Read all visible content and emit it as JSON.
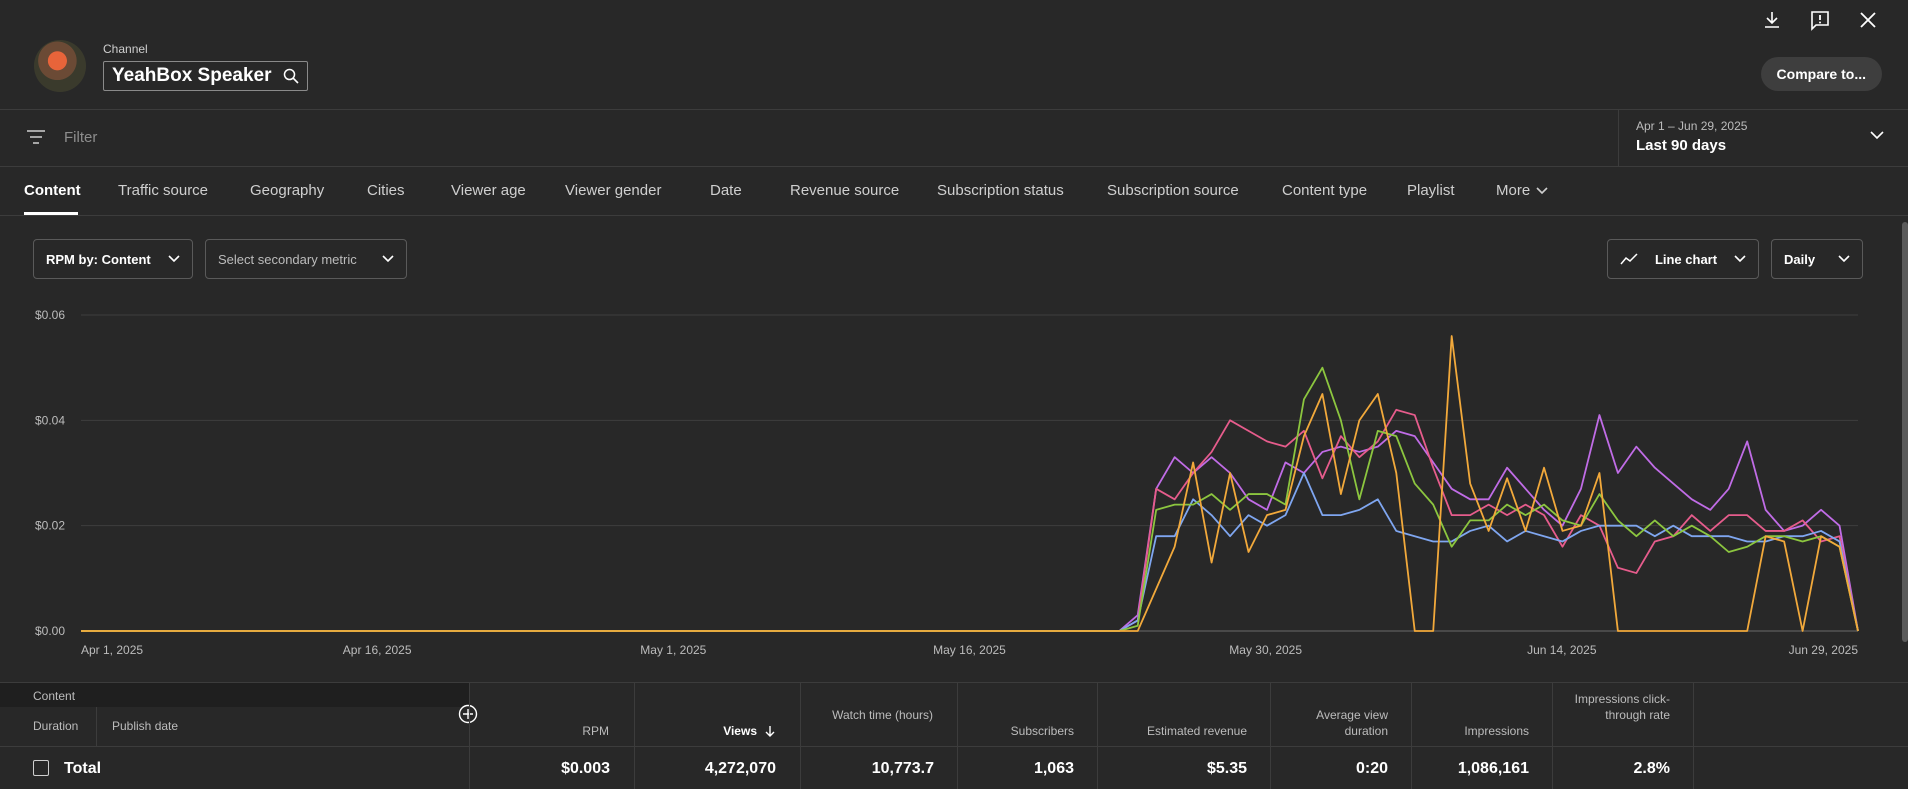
{
  "header": {
    "channel_label": "Channel",
    "channel_name": "YeahBox Speaker",
    "compare_label": "Compare to..."
  },
  "filter": {
    "placeholder": "Filter",
    "date_range": "Apr 1 – Jun 29, 2025",
    "date_label": "Last 90 days"
  },
  "tabs": [
    "Content",
    "Traffic source",
    "Geography",
    "Cities",
    "Viewer age",
    "Viewer gender",
    "Date",
    "Revenue source",
    "Subscription status",
    "Subscription source",
    "Content type",
    "Playlist",
    "More"
  ],
  "controls": {
    "primary_metric": "RPM by: Content",
    "secondary_metric": "Select secondary metric",
    "chart_type": "Line chart",
    "interval": "Daily"
  },
  "chart_data": {
    "type": "line",
    "x_labels": [
      "Apr 1, 2025",
      "Apr 16, 2025",
      "May 1, 2025",
      "May 16, 2025",
      "May 30, 2025",
      "Jun 14, 2025",
      "Jun 29, 2025"
    ],
    "y_ticks": [
      "$0.00",
      "$0.02",
      "$0.04",
      "$0.06"
    ],
    "ylim": [
      0,
      0.06
    ],
    "x_start_day": 0,
    "x_end_day": 89,
    "series_start_day": 52,
    "series": [
      {
        "color": "#c06ce6",
        "values": [
          0,
          0.003,
          0.027,
          0.033,
          0.03,
          0.033,
          0.03,
          0.025,
          0.023,
          0.032,
          0.03,
          0.034,
          0.035,
          0.034,
          0.035,
          0.038,
          0.037,
          0.032,
          0.027,
          0.025,
          0.025,
          0.031,
          0.027,
          0.023,
          0.02,
          0.027,
          0.041,
          0.03,
          0.035,
          0.031,
          0.028,
          0.025,
          0.023,
          0.027,
          0.036,
          0.023,
          0.019,
          0.02,
          0.023,
          0.02,
          0
        ]
      },
      {
        "color": "#e65c8c",
        "values": [
          0,
          0.002,
          0.027,
          0.025,
          0.03,
          0.034,
          0.04,
          0.038,
          0.036,
          0.035,
          0.038,
          0.029,
          0.037,
          0.033,
          0.036,
          0.042,
          0.041,
          0.031,
          0.022,
          0.022,
          0.024,
          0.022,
          0.024,
          0.022,
          0.016,
          0.022,
          0.02,
          0.012,
          0.011,
          0.017,
          0.018,
          0.022,
          0.019,
          0.022,
          0.022,
          0.019,
          0.019,
          0.021,
          0.017,
          0.018,
          0
        ]
      },
      {
        "color": "#7fa6f0",
        "values": [
          0,
          0.002,
          0.018,
          0.018,
          0.025,
          0.022,
          0.018,
          0.022,
          0.02,
          0.022,
          0.03,
          0.022,
          0.022,
          0.023,
          0.025,
          0.019,
          0.018,
          0.017,
          0.017,
          0.019,
          0.02,
          0.017,
          0.019,
          0.018,
          0.017,
          0.019,
          0.02,
          0.02,
          0.02,
          0.018,
          0.02,
          0.018,
          0.018,
          0.018,
          0.017,
          0.017,
          0.018,
          0.018,
          0.019,
          0.017,
          0
        ]
      },
      {
        "color": "#8cc63f",
        "values": [
          0,
          0.001,
          0.023,
          0.024,
          0.024,
          0.026,
          0.023,
          0.026,
          0.026,
          0.024,
          0.044,
          0.05,
          0.04,
          0.025,
          0.038,
          0.037,
          0.028,
          0.024,
          0.016,
          0.021,
          0.021,
          0.024,
          0.022,
          0.024,
          0.021,
          0.02,
          0.026,
          0.021,
          0.018,
          0.021,
          0.018,
          0.02,
          0.018,
          0.015,
          0.016,
          0.018,
          0.018,
          0.017,
          0.018,
          0.016,
          0
        ]
      },
      {
        "color": "#f2a93b",
        "values": [
          0,
          0,
          0.008,
          0.016,
          0.032,
          0.013,
          0.03,
          0.015,
          0.022,
          0.023,
          0.037,
          0.045,
          0.026,
          0.04,
          0.045,
          0.03,
          0,
          0,
          0.056,
          0.028,
          0.019,
          0.029,
          0.019,
          0.031,
          0.019,
          0.02,
          0.03,
          0,
          0,
          0,
          0,
          0,
          0,
          0,
          0,
          0.018,
          0.017,
          0,
          0.018,
          0.016,
          0
        ]
      }
    ]
  },
  "table": {
    "header_left": {
      "content": "Content",
      "duration": "Duration",
      "publish_date": "Publish date"
    },
    "columns": [
      "RPM",
      "Views",
      "Watch time (hours)",
      "Subscribers",
      "Estimated revenue",
      "Average view duration",
      "Impressions",
      "Impressions click-through rate"
    ],
    "total_label": "Total",
    "totals": [
      "$0.003",
      "4,272,070",
      "10,773.7",
      "1,063",
      "$5.35",
      "0:20",
      "1,086,161",
      "2.8%"
    ]
  }
}
